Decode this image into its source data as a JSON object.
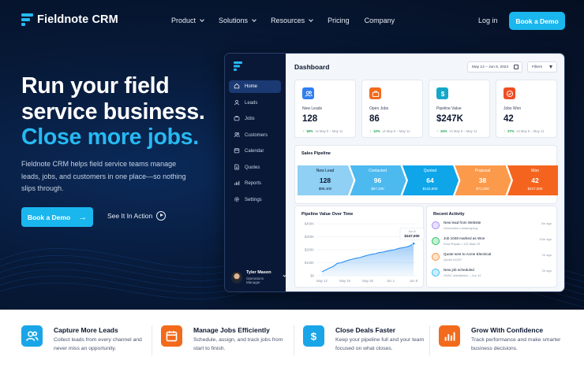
{
  "brand": {
    "name": "Fieldnote CRM"
  },
  "nav": {
    "items": [
      {
        "label": "Product",
        "dropdown": true
      },
      {
        "label": "Solutions",
        "dropdown": true
      },
      {
        "label": "Resources",
        "dropdown": true
      },
      {
        "label": "Pricing",
        "dropdown": false
      },
      {
        "label": "Company",
        "dropdown": false
      }
    ],
    "login": "Log in",
    "cta": "Book a Demo"
  },
  "hero": {
    "line1": "Run your field",
    "line2": "service business.",
    "line3": "Close more jobs.",
    "subtitle": "Fieldnote CRM helps field service teams manage leads, jobs, and customers in one place—so nothing slips through.",
    "cta": "Book a Demo",
    "secondary": "See It In Action"
  },
  "app": {
    "sidebar": [
      {
        "label": "Home",
        "icon": "home-icon",
        "active": true
      },
      {
        "label": "Leads",
        "icon": "user-icon"
      },
      {
        "label": "Jobs",
        "icon": "briefcase-icon"
      },
      {
        "label": "Customers",
        "icon": "users-icon"
      },
      {
        "label": "Calendar",
        "icon": "calendar-icon"
      },
      {
        "label": "Quotes",
        "icon": "document-icon"
      },
      {
        "label": "Reports",
        "icon": "bar-chart-icon"
      },
      {
        "label": "Settings",
        "icon": "gear-icon"
      }
    ],
    "user": {
      "name": "Tyler Mason",
      "role": "Operations Manager"
    },
    "title": "Dashboard",
    "date_range": "May 12 – Jun 8, 2024",
    "filters": "Filters",
    "kpis": [
      {
        "label": "New Leads",
        "value": "128",
        "change": "18%",
        "compare": "vs May 5 – May 11",
        "color": "#2f7ff2",
        "icon": "users-icon"
      },
      {
        "label": "Open Jobs",
        "value": "86",
        "change": "12%",
        "compare": "vs May 5 – May 11",
        "color": "#f26a1b",
        "icon": "briefcase-icon"
      },
      {
        "label": "Pipeline Value",
        "value": "$247K",
        "change": "24%",
        "compare": "vs May 5 – May 11",
        "color": "#14a7c9",
        "icon": "dollar-icon"
      },
      {
        "label": "Jobs Won",
        "value": "42",
        "change": "27%",
        "compare": "vs May 5 – May 11",
        "color": "#f04d23",
        "icon": "check-icon"
      }
    ],
    "pipeline": {
      "title": "Sales Pipeline",
      "stages": [
        {
          "name": "New Lead",
          "count": "128",
          "amount": "$98,400",
          "color": "#8fd0f4",
          "text": "#0c1730"
        },
        {
          "name": "Contacted",
          "count": "96",
          "amount": "$67,200",
          "color": "#4cb9ef",
          "text": "#ffffff"
        },
        {
          "name": "Quoted",
          "count": "64",
          "amount": "$132,800",
          "color": "#0ea5e9",
          "text": "#ffffff"
        },
        {
          "name": "Proposal",
          "count": "38",
          "amount": "$71,600",
          "color": "#fb9a4b",
          "text": "#ffffff"
        },
        {
          "name": "Won",
          "count": "42",
          "amount": "$247,000",
          "color": "#f5641e",
          "text": "#ffffff"
        }
      ]
    },
    "activity": {
      "title": "Recent Activity",
      "items": [
        {
          "title": "New lead from Website",
          "sub": "Greenview Landscaping",
          "time": "2m ago",
          "color": "#a78bfa"
        },
        {
          "title": "Job 1048 marked as Won",
          "sub": "Roof Repair • 122 Main St",
          "time": "10m ago",
          "color": "#22c55e"
        },
        {
          "title": "Quote sent to Acme Electrical",
          "sub": "Quote #1037",
          "time": "1h ago",
          "color": "#fb923c"
        },
        {
          "title": "New job scheduled",
          "sub": "HVAC Installation – Jun 12",
          "time": "2h ago",
          "color": "#38bdf8"
        }
      ]
    }
  },
  "chart_data": {
    "type": "area",
    "title": "Pipeline Value Over Time",
    "x": [
      "May 12",
      "May 19",
      "May 26",
      "Jun 1",
      "Jun 8"
    ],
    "y_ticks": [
      "$0",
      "$100K",
      "$200K",
      "$300K",
      "$400K"
    ],
    "ylim": [
      0,
      400
    ],
    "series": [
      {
        "values": [
          30,
          45,
          60,
          72,
          95,
          100,
          110,
          120,
          128,
          135,
          140,
          150,
          158,
          165,
          170,
          178,
          182,
          190,
          195,
          200,
          210,
          215,
          220,
          230,
          247
        ]
      }
    ],
    "annotation": {
      "label": "Jun 8",
      "value": "$247,000"
    },
    "grid": true,
    "color": "#2b8ff0"
  },
  "features": [
    {
      "title": "Capture More Leads",
      "desc": "Collect leads from every channel and never miss an opportunity.",
      "color": "#1aa5e8",
      "icon": "users-icon"
    },
    {
      "title": "Manage Jobs Efficiently",
      "desc": "Schedule, assign, and track jobs from start to finish.",
      "color": "#f26a1b",
      "icon": "calendar-icon"
    },
    {
      "title": "Close Deals Faster",
      "desc": "Keep your pipeline full and your team focused on what closes.",
      "color": "#1aa5e8",
      "icon": "dollar-icon"
    },
    {
      "title": "Grow With Confidence",
      "desc": "Track performance and make smarter business decisions.",
      "color": "#f26a1b",
      "icon": "bar-chart-icon"
    }
  ]
}
